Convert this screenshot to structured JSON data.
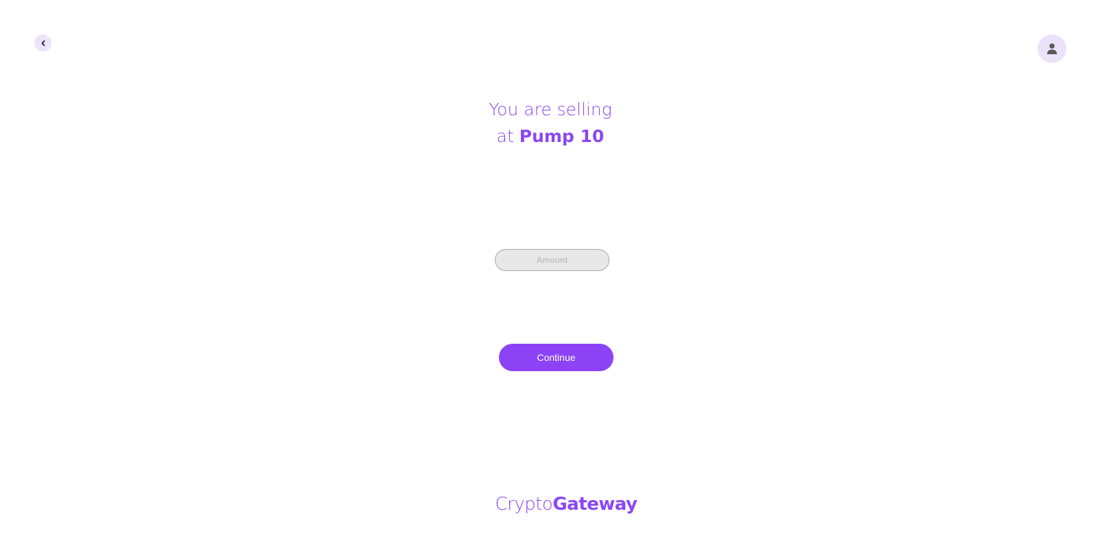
{
  "nav": {
    "back_icon": "chevron-left-icon",
    "profile_icon": "user-icon"
  },
  "heading": {
    "line1": "You are selling",
    "line2_prefix": "at ",
    "pump_name": "Pump 10"
  },
  "amount": {
    "value": "",
    "placeholder": "Amount"
  },
  "continue": {
    "label": "Continue"
  },
  "brand": {
    "part1": "Crypto",
    "part2": "Gateway"
  },
  "colors": {
    "accent": "#8b47f2",
    "button": "#8c43f6",
    "icon_bg": "#ede4fb",
    "input_bg": "#e8e8e8"
  }
}
